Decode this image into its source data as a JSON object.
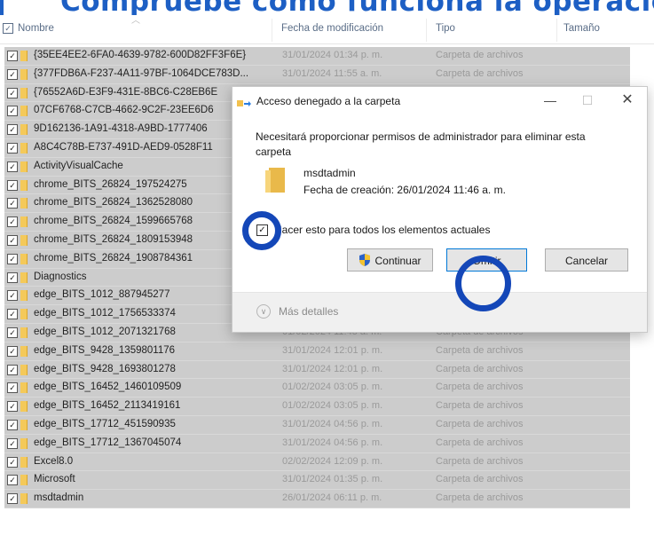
{
  "banner": {
    "text": "Compruebe cómo funciona la operación"
  },
  "header": {
    "name": "Nombre",
    "date": "Fecha de modificación",
    "type": "Tipo",
    "size": "Tamaño"
  },
  "rows": [
    {
      "name": "{35EE4EE2-6FA0-4639-9782-600D82FF3F6E}",
      "date": "31/01/2024 01:34 p. m.",
      "type": "Carpeta de archivos"
    },
    {
      "name": "{377FDB6A-F237-4A11-97BF-1064DCE783D...",
      "date": "31/01/2024 11:55 a. m.",
      "type": "Carpeta de archivos"
    },
    {
      "name": "{76552A6D-E3F9-431E-8BC6-C28EB6E",
      "date": "",
      "type": ""
    },
    {
      "name": "07CF6768-C7CB-4662-9C2F-23EE6D6",
      "date": "",
      "type": ""
    },
    {
      "name": "9D162136-1A91-4318-A9BD-1777406",
      "date": "",
      "type": ""
    },
    {
      "name": "A8C4C78B-E737-491D-AED9-0528F11",
      "date": "",
      "type": ""
    },
    {
      "name": "ActivityVisualCache",
      "date": "",
      "type": ""
    },
    {
      "name": "chrome_BITS_26824_197524275",
      "date": "",
      "type": ""
    },
    {
      "name": "chrome_BITS_26824_1362528080",
      "date": "",
      "type": ""
    },
    {
      "name": "chrome_BITS_26824_1599665768",
      "date": "",
      "type": ""
    },
    {
      "name": "chrome_BITS_26824_1809153948",
      "date": "",
      "type": ""
    },
    {
      "name": "chrome_BITS_26824_1908784361",
      "date": "",
      "type": ""
    },
    {
      "name": "Diagnostics",
      "date": "",
      "type": ""
    },
    {
      "name": "edge_BITS_1012_887945277",
      "date": "",
      "type": ""
    },
    {
      "name": "edge_BITS_1012_1756533374",
      "date": "01/02/2024 11:44 a. m.",
      "type": "Carpeta de archivos"
    },
    {
      "name": "edge_BITS_1012_2071321768",
      "date": "01/02/2024 11:45 a. m.",
      "type": "Carpeta de archivos"
    },
    {
      "name": "edge_BITS_9428_1359801176",
      "date": "31/01/2024 12:01 p. m.",
      "type": "Carpeta de archivos"
    },
    {
      "name": "edge_BITS_9428_1693801278",
      "date": "31/01/2024 12:01 p. m.",
      "type": "Carpeta de archivos"
    },
    {
      "name": "edge_BITS_16452_1460109509",
      "date": "01/02/2024 03:05 p. m.",
      "type": "Carpeta de archivos"
    },
    {
      "name": "edge_BITS_16452_2113419161",
      "date": "01/02/2024 03:05 p. m.",
      "type": "Carpeta de archivos"
    },
    {
      "name": "edge_BITS_17712_451590935",
      "date": "31/01/2024 04:56 p. m.",
      "type": "Carpeta de archivos"
    },
    {
      "name": "edge_BITS_17712_1367045074",
      "date": "31/01/2024 04:56 p. m.",
      "type": "Carpeta de archivos"
    },
    {
      "name": "Excel8.0",
      "date": "02/02/2024 12:09 p. m.",
      "type": "Carpeta de archivos"
    },
    {
      "name": "Microsoft",
      "date": "31/01/2024 01:35 p. m.",
      "type": "Carpeta de archivos"
    },
    {
      "name": "msdtadmin",
      "date": "26/01/2024 06:11 p. m.",
      "type": "Carpeta de archivos"
    }
  ],
  "dialog": {
    "title": "Acceso denegado a la carpeta",
    "message": "Necesitará proporcionar permisos de administrador para eliminar esta carpeta",
    "folder_name": "msdtadmin",
    "folder_date": "Fecha de creación: 26/01/2024 11:46 a. m.",
    "checkbox_label": "Hacer esto para todos los elementos actuales",
    "continue_label": "Continuar",
    "skip_label": "Omitir",
    "cancel_label": "Cancelar",
    "more_details": "Más detalles"
  },
  "colors": {
    "accent": "#1d5fc4",
    "highlight_ring": "#1447b8",
    "row_selected": "#cccccc"
  }
}
